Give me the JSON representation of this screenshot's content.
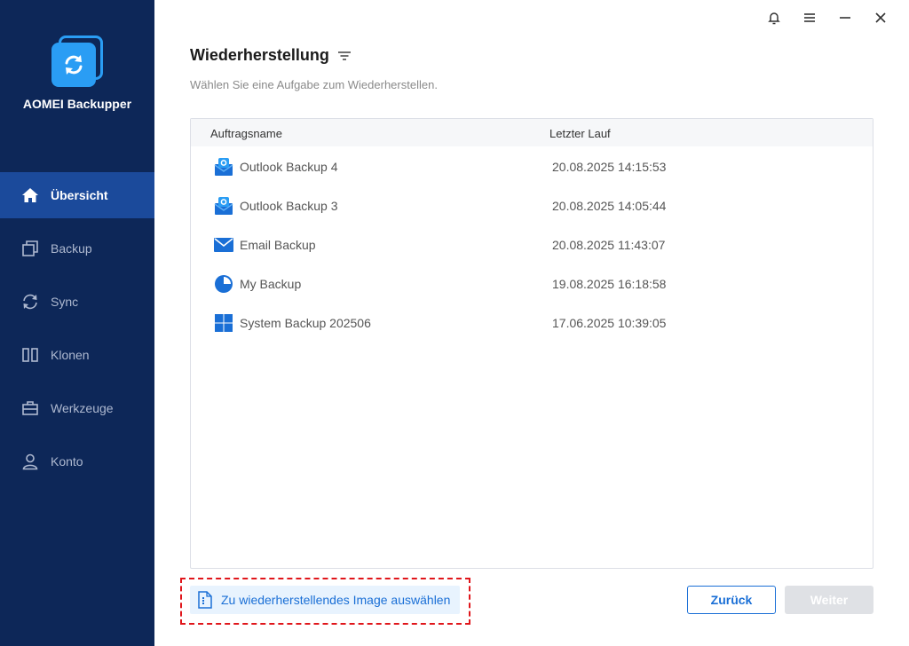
{
  "app": {
    "name": "AOMEI Backupper"
  },
  "sidebar": {
    "items": [
      {
        "label": "Übersicht",
        "icon": "home-icon",
        "active": true
      },
      {
        "label": "Backup",
        "icon": "backup-icon"
      },
      {
        "label": "Sync",
        "icon": "sync-icon"
      },
      {
        "label": "Klonen",
        "icon": "clone-icon"
      },
      {
        "label": "Werkzeuge",
        "icon": "toolbox-icon"
      },
      {
        "label": "Konto",
        "icon": "user-icon"
      }
    ]
  },
  "window_controls": [
    "bell-icon",
    "menu-icon",
    "minimize-icon",
    "close-icon"
  ],
  "main": {
    "title": "Wiederherstellung",
    "subtitle": "Wählen Sie eine Aufgabe zum Wiederherstellen.",
    "table": {
      "headers": [
        "Auftragsname",
        "Letzter Lauf"
      ],
      "rows": [
        {
          "name": "Outlook Backup 4",
          "date": "20.08.2025 14:15:53",
          "icon": "outlook-icon"
        },
        {
          "name": "Outlook Backup 3",
          "date": "20.08.2025 14:05:44",
          "icon": "outlook-icon"
        },
        {
          "name": "Email Backup",
          "date": "20.08.2025 11:43:07",
          "icon": "email-icon"
        },
        {
          "name": "My Backup",
          "date": "19.08.2025 16:18:58",
          "icon": "pie-icon"
        },
        {
          "name": "System Backup 202506",
          "date": "17.06.2025 10:39:05",
          "icon": "windows-icon"
        }
      ]
    }
  },
  "footer": {
    "select_image_label": "Zu wiederherstellendes Image auswählen",
    "back_label": "Zurück",
    "next_label": "Weiter"
  },
  "colors": {
    "sidebar_bg": "#0d2758",
    "sidebar_active": "#1b4a9b",
    "accent": "#1a6fd6",
    "highlight_border": "#e0161b"
  }
}
